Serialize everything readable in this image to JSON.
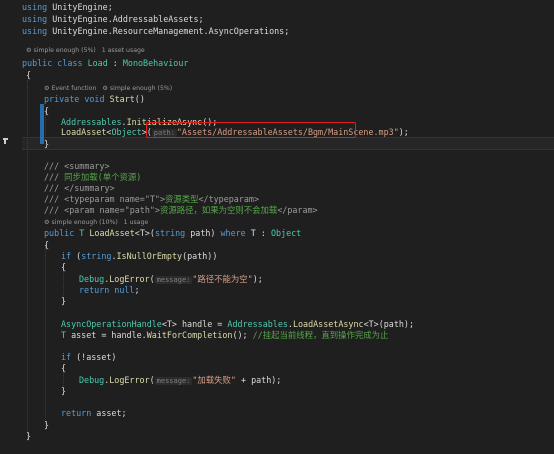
{
  "lines": {
    "l1": [
      "using",
      " UnityEngine;"
    ],
    "l2": [
      "using",
      " UnityEngine.AddressableAssets;"
    ],
    "l3": [
      "using",
      " UnityEngine.ResourceManagement.AsyncOperations;"
    ],
    "lens1": "⚙ simple enough (5%)   1 asset usage",
    "l5a": "public class ",
    "l5b": "Load",
    "l5c": " : ",
    "l5d": "MonoBehaviour",
    "l6": "{",
    "lens2": "⚙ Event function   ⚙ simple enough (5%)",
    "l8a": "private void ",
    "l8b": "Start",
    "l8c": "()",
    "l9": "{",
    "l10a": "Addressables",
    "l10b": ".",
    "l10c": "InitializeAsync",
    "l10d": "();",
    "l11a": "LoadAsset",
    "l11b": "<",
    "l11c": "Object",
    "l11d": ">(",
    "l11hint": "path:",
    "l11s": "\"Assets/AddressableAssets/Bgm/MainScene.mp3\"",
    "l11e": ");",
    "l12": "}",
    "l14a": "/// ",
    "l14b": "<summary>",
    "l15a": "/// ",
    "l15b": "同步加载(单个资源)",
    "l16a": "/// ",
    "l16b": "</summary>",
    "l17a": "/// ",
    "l17b": "<typeparam name=\"T\">",
    "l17c": "资源类型",
    "l17d": "</typeparam>",
    "l18a": "/// ",
    "l18b": "<param name=\"path\">",
    "l18c": "资源路径，如果为空则不会加载",
    "l18d": "</param>",
    "lens3": "⚙ simple enough (10%)   1 usage",
    "l20a": "public ",
    "l20b": "T ",
    "l20c": "LoadAsset",
    "l20d": "<T>(",
    "l20e": "string",
    "l20f": " path) ",
    "l20g": "where",
    "l20h": " T : ",
    "l20i": "Object",
    "l21": "{",
    "l22a": "if",
    "l22b": " (",
    "l22c": "string",
    "l22d": ".",
    "l22e": "IsNullOrEmpty",
    "l22f": "(path))",
    "l23": "{",
    "l24a": "Debug",
    "l24b": ".",
    "l24c": "LogError",
    "l24d": "(",
    "l24hint": "message:",
    "l24s": "\"路径不能为空\"",
    "l24e": ");",
    "l25a": "return",
    "l25b": " null",
    "l25c": ";",
    "l26": "}",
    "l28a": "AsyncOperationHandle",
    "l28b": "<T> handle = ",
    "l28c": "Addressables",
    "l28d": ".",
    "l28e": "LoadAssetAsync",
    "l28f": "<T>(path);",
    "l29a": "T",
    "l29b": " asset = handle.",
    "l29c": "WaitForCompletion",
    "l29d": "(); ",
    "l29e": "//挂起当前线程，直到操作完成为止",
    "l31a": "if",
    "l31b": " (!asset)",
    "l32": "{",
    "l33a": "Debug",
    "l33b": ".",
    "l33c": "LogError",
    "l33d": "(",
    "l33hint": "message:",
    "l33s": "\"加载失败\"",
    "l33e": " + path);",
    "l34": "}",
    "l36a": "return",
    "l36b": " asset;",
    "l37": "}",
    "l38": "}"
  }
}
